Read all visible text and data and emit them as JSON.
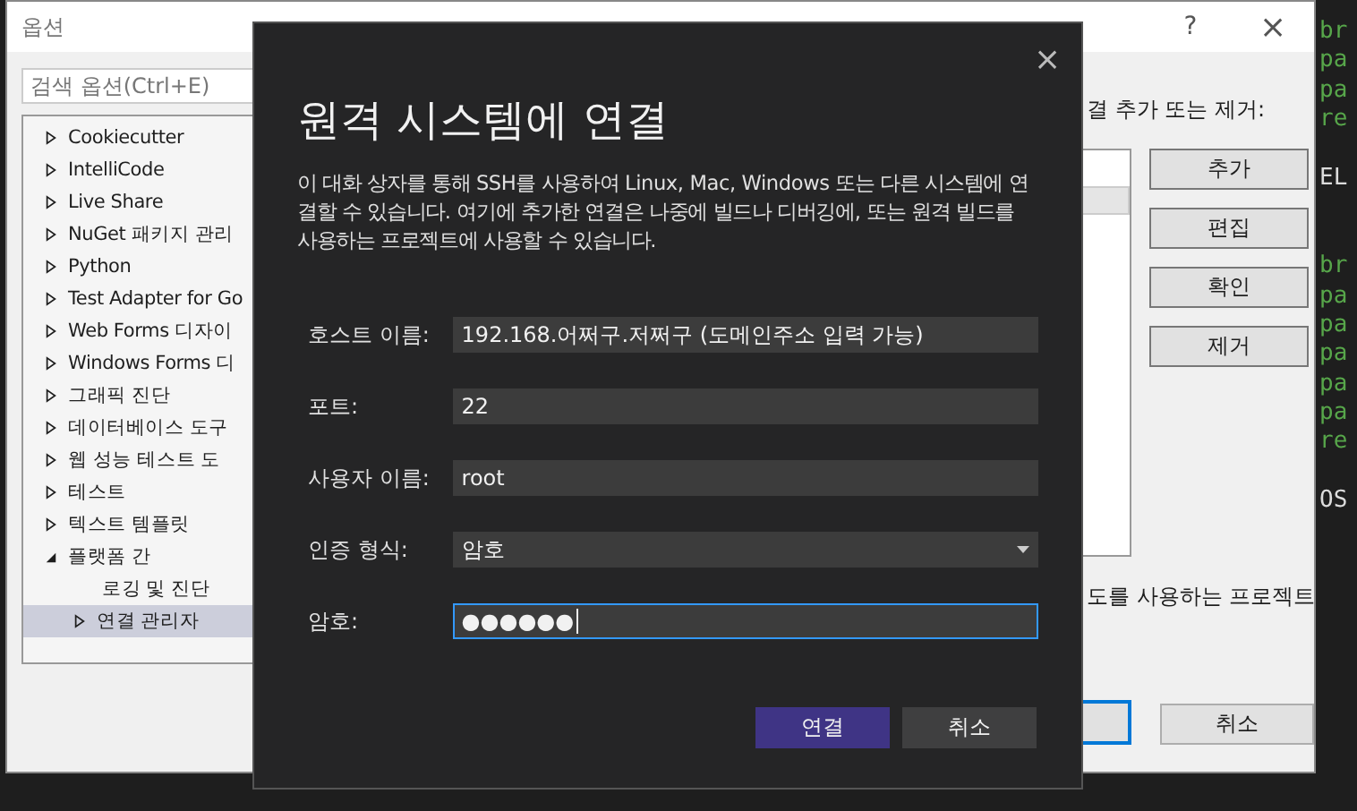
{
  "editor": {
    "lines": [
      {
        "kind": "green",
        "text": "br"
      },
      {
        "kind": "green",
        "text": "pa"
      },
      {
        "kind": "green",
        "text": "pa"
      },
      {
        "kind": "green",
        "text": "re"
      },
      {
        "kind": "blank"
      },
      {
        "kind": "plain",
        "text": "EL"
      },
      {
        "kind": "blank"
      },
      {
        "kind": "blank"
      },
      {
        "kind": "green",
        "text": "br"
      },
      {
        "kind": "green",
        "text": "pa"
      },
      {
        "kind": "green",
        "text": "pa"
      },
      {
        "kind": "green",
        "text": "pa"
      },
      {
        "kind": "green",
        "text": "pa"
      },
      {
        "kind": "green",
        "text": "pa"
      },
      {
        "kind": "green",
        "text": "re"
      },
      {
        "kind": "blank"
      },
      {
        "kind": "plain",
        "text": "OS"
      }
    ]
  },
  "options_window": {
    "title": "옵션",
    "help": "?",
    "close": "×",
    "search": {
      "placeholder": "검색 옵션(Ctrl+E)"
    },
    "tree": [
      {
        "label": "Cookiecutter",
        "expanded": false,
        "selected": false
      },
      {
        "label": "IntelliCode",
        "expanded": false,
        "selected": false
      },
      {
        "label": "Live Share",
        "expanded": false,
        "selected": false
      },
      {
        "label": "NuGet 패키지 관리",
        "expanded": false,
        "selected": false
      },
      {
        "label": "Python",
        "expanded": false,
        "selected": false
      },
      {
        "label": "Test Adapter for Go",
        "expanded": false,
        "selected": false
      },
      {
        "label": "Web Forms 디자이",
        "expanded": false,
        "selected": false
      },
      {
        "label": "Windows Forms 디",
        "expanded": false,
        "selected": false
      },
      {
        "label": "그래픽 진단",
        "expanded": false,
        "selected": false
      },
      {
        "label": "데이터베이스 도구",
        "expanded": false,
        "selected": false
      },
      {
        "label": "웹 성능 테스트 도",
        "expanded": false,
        "selected": false
      },
      {
        "label": "테스트",
        "expanded": false,
        "selected": false
      },
      {
        "label": "텍스트 템플릿",
        "expanded": false,
        "selected": false
      },
      {
        "label": "플랫폼 간",
        "expanded": true,
        "selected": false,
        "children": [
          {
            "label": "로깅 및 진단",
            "selected": false
          },
          {
            "label": "연결 관리자",
            "expanded": false,
            "selected": true
          }
        ]
      }
    ],
    "section_label": "결 추가 또는 제거:",
    "side_buttons": [
      "추가",
      "편집",
      "확인",
      "제거"
    ],
    "note": "도를 사용하는 프로젝트",
    "cancel": "취소"
  },
  "dialog": {
    "close": "×",
    "title": "원격 시스템에 연결",
    "description": "이 대화 상자를 통해 SSH를 사용하여 Linux, Mac, Windows 또는 다른 시스템에 연결할 수 있습니다. 여기에 추가한 연결은 나중에 빌드나 디버깅에, 또는 원격 빌드를 사용하는 프로젝트에 사용할 수 있습니다.",
    "fields": [
      {
        "kind": "text",
        "label": "호스트 이름:",
        "value": "192.168.어쩌구.저쩌구 (도메인주소 입력 가능)",
        "focused": false
      },
      {
        "kind": "text",
        "label": "포트:",
        "value": "22",
        "focused": false
      },
      {
        "kind": "text",
        "label": "사용자 이름:",
        "value": "root",
        "focused": false
      },
      {
        "kind": "select",
        "label": "인증 형식:",
        "value": "암호",
        "focused": false
      },
      {
        "kind": "password",
        "label": "암호:",
        "value": "●●●●●●",
        "focused": true
      }
    ],
    "buttons": [
      {
        "label": "연결",
        "primary": true
      },
      {
        "label": "취소",
        "primary": false
      }
    ]
  }
}
